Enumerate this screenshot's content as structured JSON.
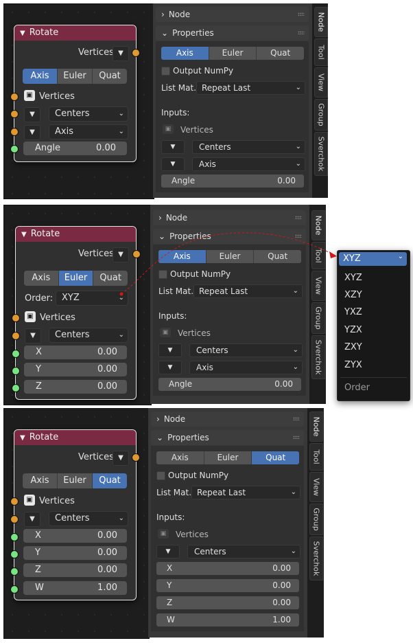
{
  "node": {
    "title": "Rotate",
    "output_label": "Vertices",
    "modes": [
      "Axis",
      "Euler",
      "Quat"
    ],
    "input_vertices": "Vertices",
    "centers": "Centers",
    "axis": "Axis",
    "angle_label": "Angle",
    "angle_value": "0.00",
    "order_label": "Order:",
    "order_value": "XYZ",
    "x_label": "X",
    "y_label": "Y",
    "z_label": "Z",
    "w_label": "W",
    "zero": "0.00",
    "one": "1.00"
  },
  "sidebar": {
    "node_header": "Node",
    "properties_header": "Properties",
    "modes": [
      "Axis",
      "Euler",
      "Quat"
    ],
    "output_numpy": "Output NumPy",
    "list_match_label": "List Mat...",
    "list_match_value": "Repeat Last",
    "inputs_label": "Inputs:",
    "vertices": "Vertices",
    "centers": "Centers",
    "axis": "Axis",
    "angle": "Angle",
    "x": "X",
    "y": "Y",
    "z": "Z",
    "w": "W",
    "zero": "0.00",
    "one": "1.00",
    "tabs": [
      "Node",
      "Tool",
      "View",
      "Group",
      "Sverchok"
    ]
  },
  "order_menu": {
    "current": "XYZ",
    "items": [
      "XYZ",
      "XZY",
      "YXZ",
      "YZX",
      "ZXY",
      "ZYX"
    ],
    "title": "Order"
  },
  "states": [
    {
      "active_mode": "Axis"
    },
    {
      "active_mode": "Euler"
    },
    {
      "active_mode": "Quat"
    }
  ],
  "colors": {
    "header": "#7a2a43",
    "active": "#4772b3",
    "socket_vertices": "#e09932",
    "socket_float": "#79e482",
    "link": "#d01818"
  }
}
